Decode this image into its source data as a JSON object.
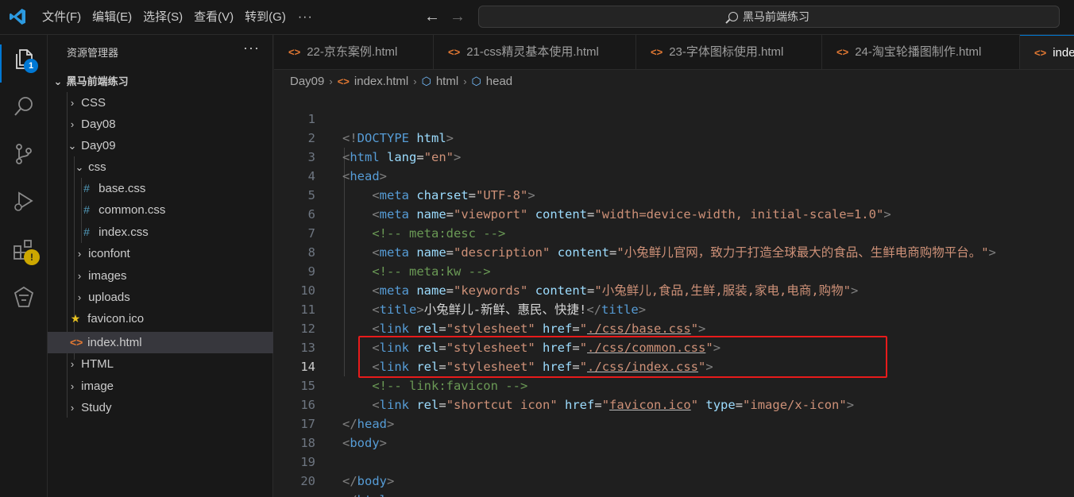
{
  "titlebar": {
    "menu": [
      "文件(F)",
      "编辑(E)",
      "选择(S)",
      "查看(V)",
      "转到(G)"
    ],
    "more": "···",
    "search_text": "黑马前端练习"
  },
  "activity": {
    "explorer_badge": "1",
    "extensions_badge": "!"
  },
  "sidebar": {
    "title": "资源管理器",
    "more": "···",
    "root": "黑马前端练习",
    "items": [
      {
        "label": "CSS",
        "kind": "folder-collapsed"
      },
      {
        "label": "Day08",
        "kind": "folder-collapsed"
      },
      {
        "label": "Day09",
        "kind": "folder-expanded"
      },
      {
        "label": "css",
        "kind": "folder-expanded"
      },
      {
        "label": "base.css",
        "kind": "css"
      },
      {
        "label": "common.css",
        "kind": "css"
      },
      {
        "label": "index.css",
        "kind": "css"
      },
      {
        "label": "iconfont",
        "kind": "folder-collapsed"
      },
      {
        "label": "images",
        "kind": "folder-collapsed"
      },
      {
        "label": "uploads",
        "kind": "folder-collapsed"
      },
      {
        "label": "favicon.ico",
        "kind": "ico"
      },
      {
        "label": "index.html",
        "kind": "html"
      },
      {
        "label": "HTML",
        "kind": "folder-collapsed"
      },
      {
        "label": "image",
        "kind": "folder-collapsed"
      },
      {
        "label": "Study",
        "kind": "folder-collapsed"
      }
    ]
  },
  "tabs": [
    {
      "label": "22-京东案例.html"
    },
    {
      "label": "21-css精灵基本使用.html"
    },
    {
      "label": "23-字体图标使用.html"
    },
    {
      "label": "24-淘宝轮播图制作.html"
    },
    {
      "label": "index.html"
    }
  ],
  "breadcrumb": [
    "Day09",
    "index.html",
    "html",
    "head"
  ],
  "editor": {
    "line_numbers": [
      "1",
      "2",
      "3",
      "4",
      "5",
      "6",
      "7",
      "8",
      "9",
      "10",
      "11",
      "12",
      "13",
      "14",
      "15",
      "16",
      "17",
      "18",
      "19",
      "20"
    ],
    "current_line": "14"
  },
  "colors": {
    "accent": "#0078d4",
    "tag": "#569cd6",
    "attribute": "#9cdcfe",
    "string": "#ce9178",
    "comment": "#6a9955",
    "highlight_box": "#e81b1b"
  }
}
